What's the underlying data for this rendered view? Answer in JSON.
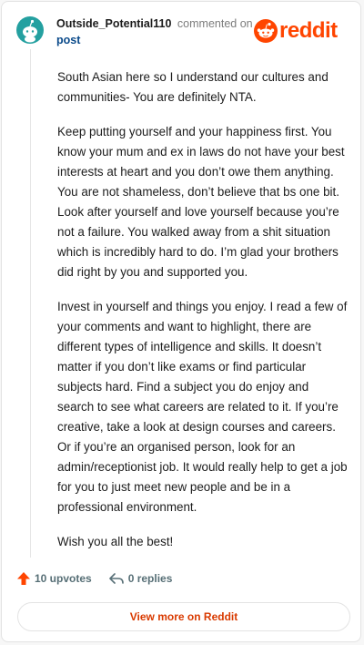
{
  "colors": {
    "brand": "#ff4500",
    "avatar_bg": "#24a0a0",
    "link": "#0a4a8a",
    "muted": "#7c7c7c",
    "cta": "#d93a00"
  },
  "header": {
    "author": "Outside_Potential110",
    "action": "commented on",
    "post_link": "post",
    "brand": "reddit",
    "avatar_icon": "snoo-avatar-icon",
    "logo_icon": "reddit-snoo-icon"
  },
  "comment": {
    "paragraphs": [
      "South Asian here so I understand our cultures and communities- You are definitely NTA.",
      "Keep putting yourself and your happiness first. You know your mum and ex in laws do not have your best interests at heart and you don’t owe them anything. You are not shameless, don’t believe that bs one bit. Look after yourself and love yourself because you’re not a failure. You walked away from a shit situation which is incredibly hard to do. I’m glad your brothers did right by you and supported you.",
      "Invest in yourself and things you enjoy. I read a few of your comments and want to highlight, there are different types of intelligence and skills. It doesn’t matter if you don’t like exams or find particular subjects hard. Find a subject you do enjoy and search to see what careers are related to it. If you’re creative, take a look at design courses and careers. Or if you’re an organised person, look for an admin/receptionist job. It would really help to get a job for you to just meet new people and be in a professional environment.",
      "Wish you all the best!"
    ]
  },
  "footer": {
    "upvotes": "10 upvotes",
    "replies": "0 replies",
    "upvote_icon": "upvote-arrow-icon",
    "reply_icon": "reply-arrow-icon"
  },
  "cta": {
    "label": "View more on Reddit"
  }
}
